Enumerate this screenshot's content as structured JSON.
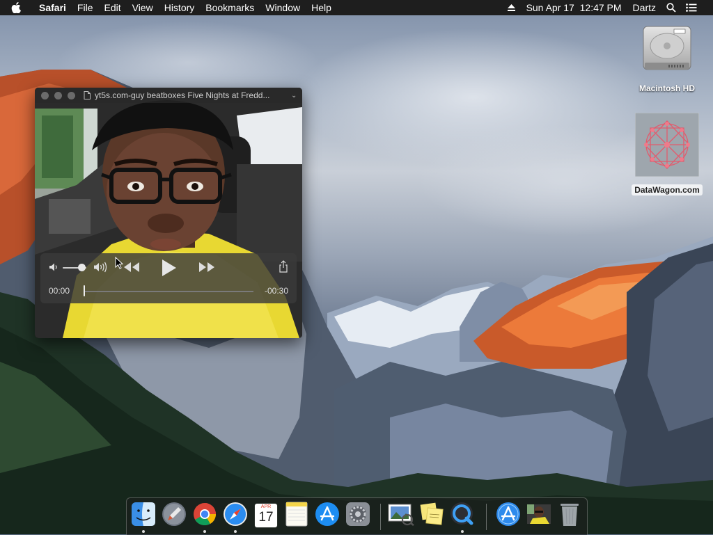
{
  "menubar": {
    "app_name": "Safari",
    "menus": [
      "File",
      "Edit",
      "View",
      "History",
      "Bookmarks",
      "Window",
      "Help"
    ],
    "clock": "Sun Apr 17  12:47 PM",
    "user": "Dartz"
  },
  "desktop": {
    "icons": [
      {
        "label": "Macintosh HD",
        "icon": "hard-drive-icon"
      },
      {
        "label": "DataWagon.com",
        "icon": "datawagon-image-icon"
      }
    ]
  },
  "quicktime": {
    "title": "yt5s.com-guy beatboxes Five Nights at Fredd...",
    "time_current": "00:00",
    "time_remaining": "-00:30",
    "progress": 0.0,
    "volume": 0.8
  },
  "dock": {
    "items": [
      {
        "name": "Finder",
        "icon": "finder-icon",
        "running": true
      },
      {
        "name": "Launchpad",
        "icon": "launchpad-icon",
        "running": false
      },
      {
        "name": "Google Chrome",
        "icon": "chrome-icon",
        "running": true
      },
      {
        "name": "Safari",
        "icon": "safari-icon",
        "running": true
      },
      {
        "name": "Calendar",
        "icon": "calendar-icon",
        "running": false,
        "month": "APR",
        "day": "17"
      },
      {
        "name": "Notes",
        "icon": "notes-icon",
        "running": false
      },
      {
        "name": "App Store",
        "icon": "app-store-icon",
        "running": false
      },
      {
        "name": "System Preferences",
        "icon": "system-preferences-icon",
        "running": false
      },
      {
        "name": "Preview",
        "icon": "preview-icon",
        "running": false
      },
      {
        "name": "Stickies",
        "icon": "stickies-icon",
        "running": false
      },
      {
        "name": "QuickTime Player",
        "icon": "quicktime-icon",
        "running": true
      },
      {
        "name": "Applications",
        "icon": "applications-folder-icon",
        "running": false
      },
      {
        "name": "Video thumbnail",
        "icon": "video-thumbnail-icon",
        "running": false
      },
      {
        "name": "Trash",
        "icon": "trash-icon",
        "running": false
      }
    ]
  }
}
